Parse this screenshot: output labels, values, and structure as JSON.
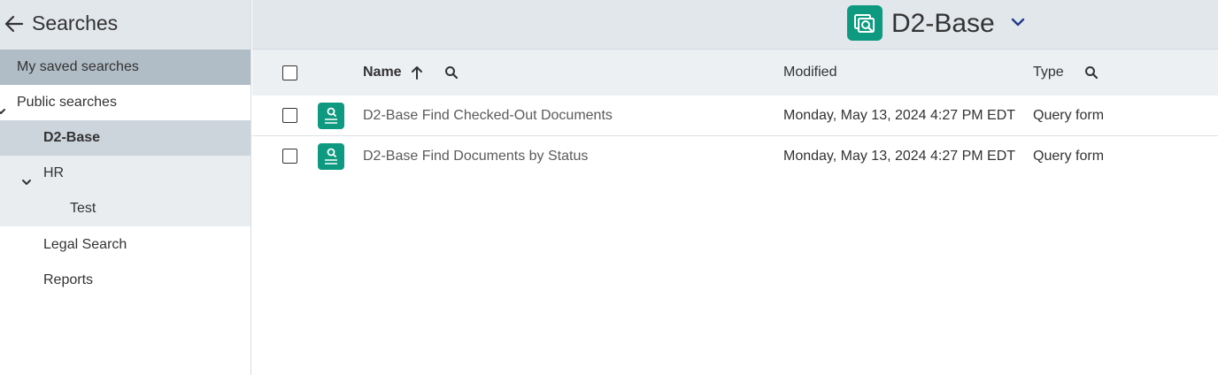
{
  "sidebar": {
    "title": "Searches",
    "items": [
      {
        "label": "My saved searches"
      },
      {
        "label": "Public searches"
      },
      {
        "label": "D2-Base"
      },
      {
        "label": "HR"
      },
      {
        "label": "Test"
      },
      {
        "label": "Legal Search"
      },
      {
        "label": "Reports"
      }
    ]
  },
  "header": {
    "title": "D2-Base"
  },
  "table": {
    "columns": {
      "name": "Name",
      "modified": "Modified",
      "type": "Type"
    },
    "sort": "ascending",
    "rows": [
      {
        "name": "D2-Base Find Checked-Out Documents",
        "modified": "Monday, May 13, 2024 4:27 PM EDT",
        "type": "Query form"
      },
      {
        "name": "D2-Base Find Documents by Status",
        "modified": "Monday, May 13, 2024 4:27 PM EDT",
        "type": "Query form"
      }
    ]
  },
  "colors": {
    "accent": "#0e9a80",
    "header_bg": "#e2e7eb",
    "selected_bg": "#cdd5dc",
    "saved_bg": "#b1bdc6"
  },
  "icons": {
    "back": "arrow-left-icon",
    "header": "search-folder-icon",
    "caret": "chevron-down-icon",
    "sort": "arrow-up-icon",
    "search": "search-icon",
    "query": "query-form-icon"
  }
}
